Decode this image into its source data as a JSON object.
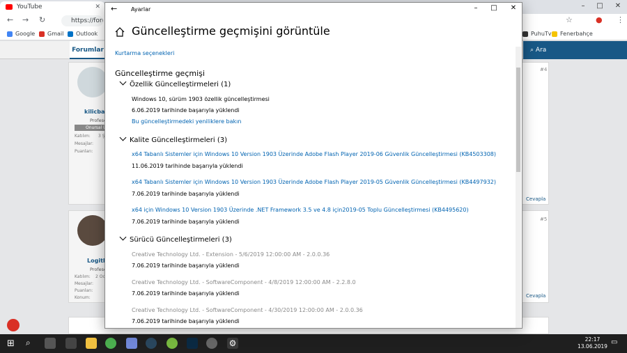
{
  "browser": {
    "tab_label": "YouTube",
    "address": "https://forum",
    "bookmarks": [
      "Google",
      "Gmail",
      "Outlook",
      "PuhuTv",
      "Fenerbahçe"
    ]
  },
  "site": {
    "nav_forum": "Forumlar",
    "nav_search": "Ara",
    "posts": [
      {
        "user": "kilicbal",
        "title": "Profesö",
        "rank": "Onursal Ü",
        "fields": [
          "Katılım:",
          "Mesajlar:",
          "Puanları:"
        ],
        "joined": "3 Ş",
        "num": "#4",
        "reply": "Cevapla"
      },
      {
        "user": "Logith",
        "title": "Profesö",
        "fields": [
          "Katılım:",
          "Mesajlar:",
          "Puanları:",
          "Konum:"
        ],
        "joined": "2 Oc",
        "num": "#5",
        "reply": "Cevapla"
      }
    ]
  },
  "settings": {
    "window_title": "Ayarlar",
    "page_title": "Güncelleştirme geçmişini görüntüle",
    "recovery_link": "Kurtarma seçenekleri",
    "history_heading": "Güncelleştirme geçmişi",
    "groups": {
      "feature": {
        "title": "Özellik Güncelleştirmeleri (1)",
        "item_name": "Windows 10, sürüm 1903 özellik güncelleştirmesi",
        "item_status": "6.06.2019 tarihinde başarıyla yüklendi",
        "item_link": "Bu güncelleştirmedeki yeniliklere bakın"
      },
      "quality": {
        "title": "Kalite Güncelleştirmeleri (3)",
        "items": [
          {
            "name": "x64 Tabanlı Sistemler için Windows 10 Version 1903 Üzerinde Adobe Flash Player 2019-06 Güvenlik Güncelleştirmesi (KB4503308)",
            "status": "11.06.2019 tarihinde başarıyla yüklendi"
          },
          {
            "name": "x64 Tabanlı Sistemler için Windows 10 Version 1903 Üzerinde Adobe Flash Player 2019-05 Güvenlik Güncelleştirmesi (KB4497932)",
            "status": "7.06.2019 tarihinde başarıyla yüklendi"
          },
          {
            "name": "x64 için Windows 10 Version 1903 Üzerinde .NET Framework 3.5 ve 4.8 için2019-05 Toplu Güncelleştirmesi (KB4495620)",
            "status": "7.06.2019 tarihinde başarıyla yüklendi"
          }
        ]
      },
      "driver": {
        "title": "Sürücü Güncelleştirmeleri (3)",
        "items": [
          {
            "name": "Creative Technology Ltd. - Extension - 5/6/2019 12:00:00 AM - 2.0.0.36",
            "status": "7.06.2019 tarihinde başarıyla yüklendi"
          },
          {
            "name": "Creative Technology Ltd. - SoftwareComponent - 4/8/2019 12:00:00 AM - 2.2.8.0",
            "status": "7.06.2019 tarihinde başarıyla yüklendi"
          },
          {
            "name": "Creative Technology Ltd. - SoftwareComponent - 4/30/2019 12:00:00 AM - 2.0.0.36",
            "status": "7.06.2019 tarihinde başarıyla yüklendi"
          }
        ]
      }
    }
  },
  "taskbar": {
    "time": "22:17",
    "date": "13.06.2019"
  },
  "colors": {
    "link": "#0063b1",
    "accent": "#185886",
    "taskbar": "#1f1f1f"
  }
}
